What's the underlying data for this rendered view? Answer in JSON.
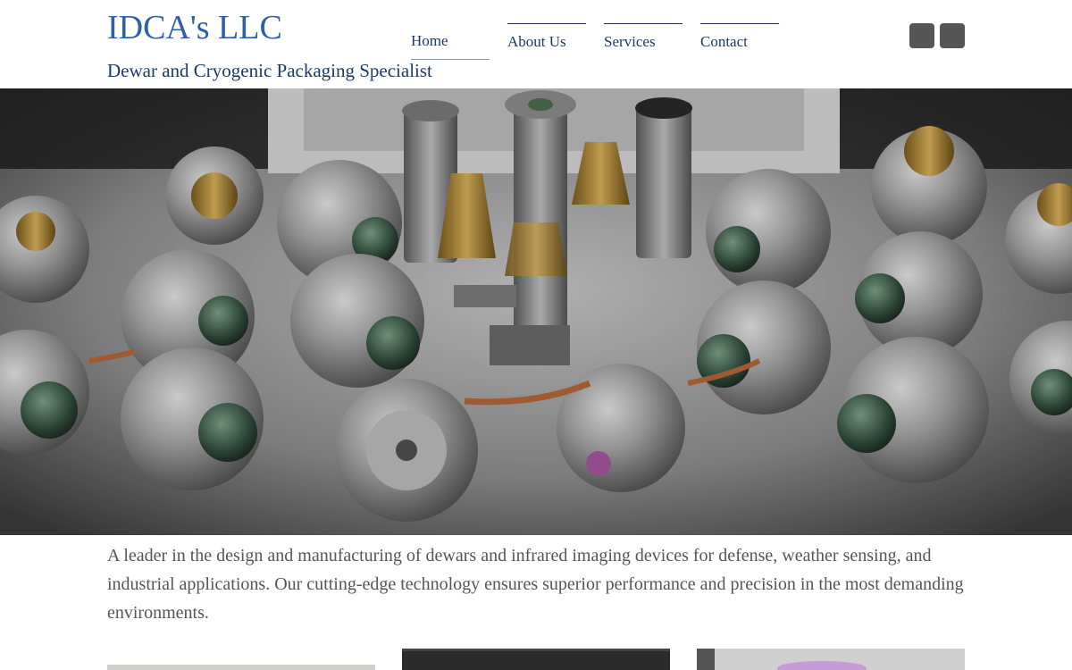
{
  "header": {
    "site_title": "IDCA's LLC",
    "tagline": "Dewar and Cryogenic Packaging Specialist"
  },
  "nav": {
    "items": [
      {
        "label": "Home",
        "active": true
      },
      {
        "label": "About Us",
        "active": false
      },
      {
        "label": "Services",
        "active": false
      },
      {
        "label": "Contact",
        "active": false
      }
    ]
  },
  "social": {
    "icons": [
      "social-icon",
      "social-icon"
    ],
    "color": "#555555"
  },
  "hero": {
    "image": "cryogenic-dewar-assemblies-photo"
  },
  "intro": {
    "text": "A leader in the design and manufacturing of dewars and infrared imaging devices for defense, weather sensing, and industrial applications. Our cutting-edge technology ensures superior performance and precision in the most demanding environments."
  },
  "thumbnails": [
    {
      "image": "lab-photo"
    },
    {
      "image": "equipment-photo-dark"
    },
    {
      "image": "device-photo-light"
    }
  ],
  "colors": {
    "title": "#2f5fa6",
    "tagline": "#1c3a66",
    "body_text": "#555555"
  }
}
